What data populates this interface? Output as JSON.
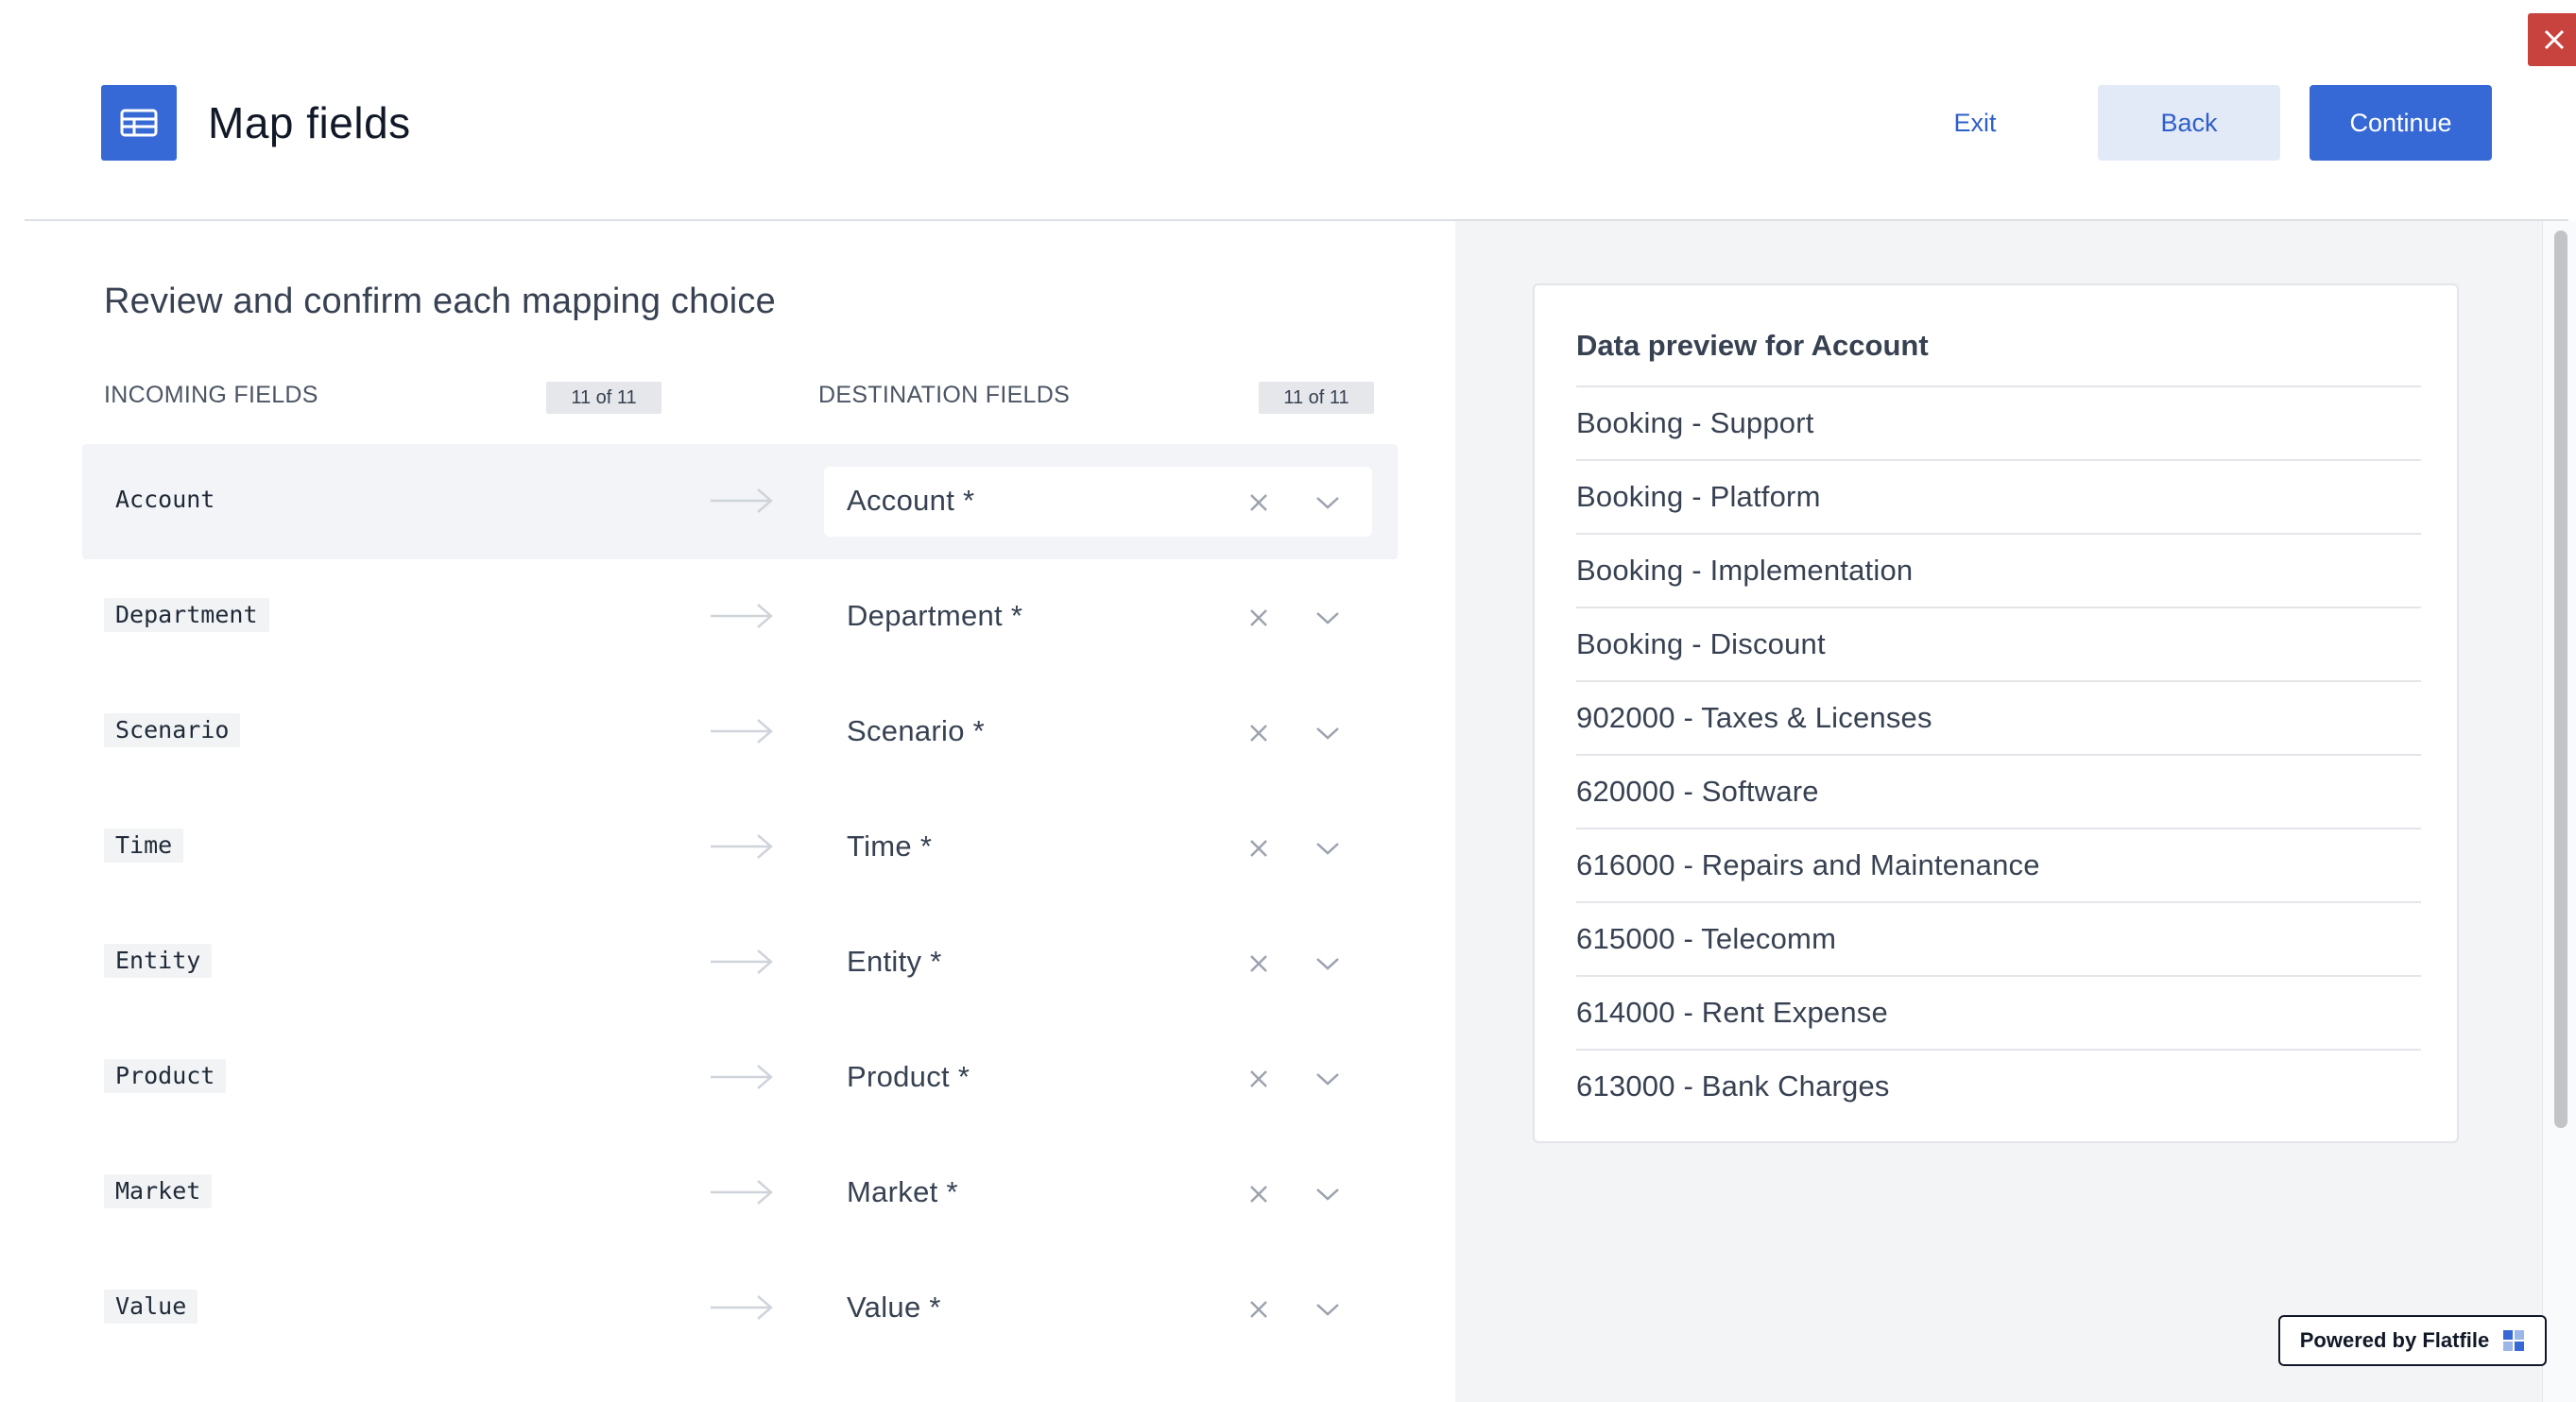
{
  "header": {
    "title": "Map fields",
    "title_icon": "table-icon",
    "exit_label": "Exit",
    "back_label": "Back",
    "continue_label": "Continue",
    "close_icon": "close-icon"
  },
  "mapping": {
    "section_title": "Review and confirm each mapping choice",
    "incoming_header": "INCOMING FIELDS",
    "incoming_count": "11 of 11",
    "destination_header": "DESTINATION FIELDS",
    "destination_count": "11 of 11",
    "rows": [
      {
        "incoming": "Account",
        "destination": "Account *"
      },
      {
        "incoming": "Department",
        "destination": "Department *"
      },
      {
        "incoming": "Scenario",
        "destination": "Scenario *"
      },
      {
        "incoming": "Time",
        "destination": "Time *"
      },
      {
        "incoming": "Entity",
        "destination": "Entity *"
      },
      {
        "incoming": "Product",
        "destination": "Product *"
      },
      {
        "incoming": "Market",
        "destination": "Market *"
      },
      {
        "incoming": "Value",
        "destination": "Value *"
      }
    ]
  },
  "preview": {
    "title": "Data preview for Account",
    "items": [
      "Booking - Support",
      "Booking - Platform",
      "Booking - Implementation",
      "Booking - Discount",
      "902000 - Taxes & Licenses",
      "620000 - Software",
      "616000 - Repairs and Maintenance",
      "615000 - Telecomm",
      "614000 - Rent Expense",
      "613000 - Bank Charges"
    ]
  },
  "footer": {
    "powered_by": "Powered by Flatfile",
    "logo_icon": "flatfile-logo-icon"
  },
  "colors": {
    "accent": "#3769d6",
    "close": "#c9433e",
    "back_bg": "#e3eaf7"
  }
}
